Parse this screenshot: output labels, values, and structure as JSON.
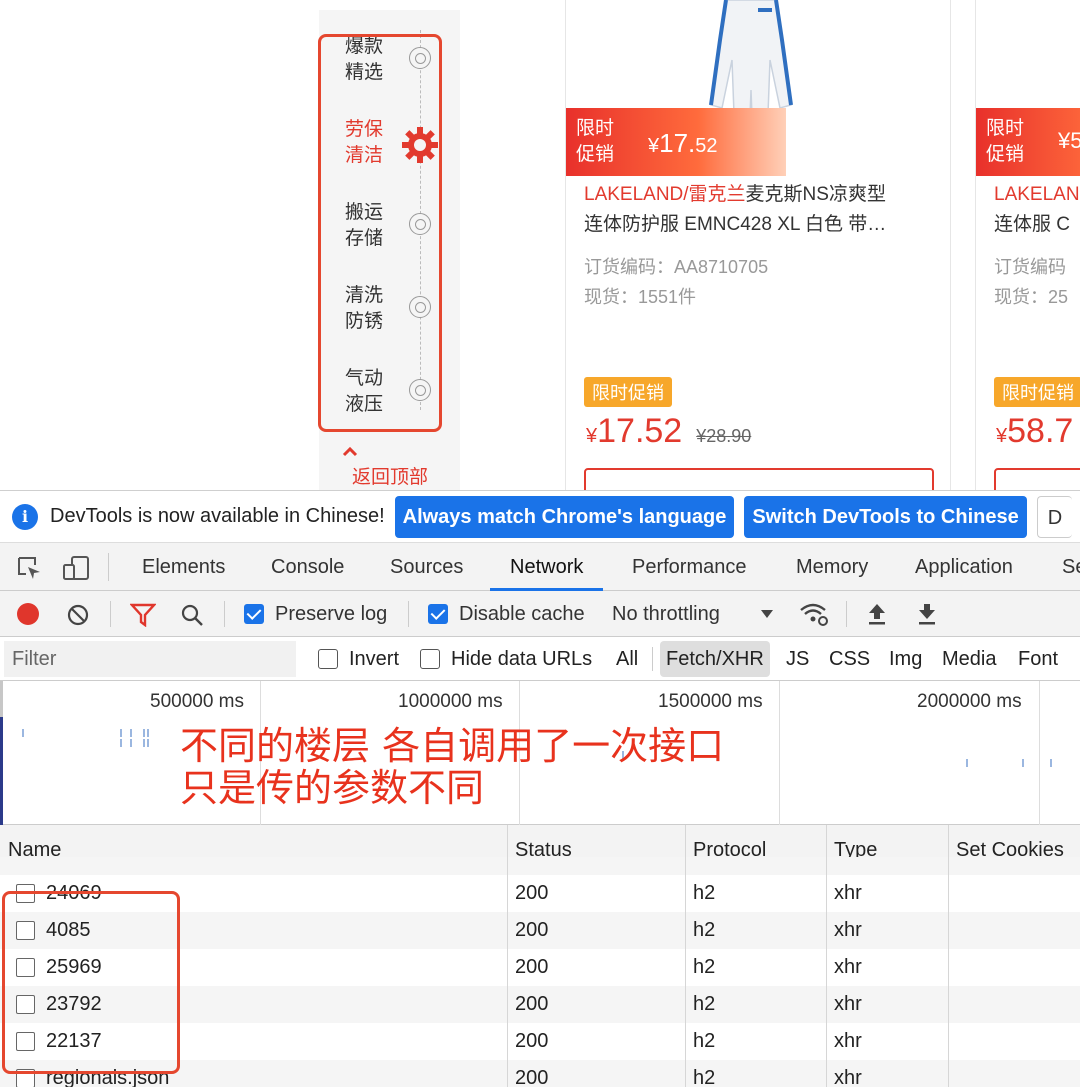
{
  "floor_nav": {
    "items": [
      {
        "label_line1": "爆款",
        "label_line2": "精选",
        "active": false
      },
      {
        "label_line1": "劳保",
        "label_line2": "清洁",
        "active": true
      },
      {
        "label_line1": "搬运",
        "label_line2": "存储",
        "active": false
      },
      {
        "label_line1": "清洗",
        "label_line2": "防锈",
        "active": false
      },
      {
        "label_line1": "气动",
        "label_line2": "液压",
        "active": false
      }
    ],
    "back_to_top": "返回顶部"
  },
  "products": [
    {
      "promo_tag_line1": "限时",
      "promo_tag_line2": "促销",
      "promo_currency": "¥",
      "promo_price_int": "17.",
      "promo_price_dec": "52",
      "brand": "LAKELAND/雷克兰",
      "title_rest": "麦克斯NS凉爽型",
      "title_line2": "连体防护服 EMNC428 XL 白色 带…",
      "order_code": "订货编码：AA8710705",
      "stock": "现货：1551件",
      "badge": "限时促销",
      "currency": "¥",
      "price": "17.52",
      "orig_price": "¥28.90"
    },
    {
      "promo_tag_line1": "限时",
      "promo_tag_line2": "促销",
      "promo_currency": "¥5",
      "brand": "LAKELAN",
      "title_line2": "连体服 C",
      "order_code": "订货编码",
      "stock": "现货：25",
      "badge": "限时促销",
      "currency": "¥",
      "price": "58.7"
    }
  ],
  "devtools": {
    "infobar": {
      "icon": "info-icon",
      "text": "DevTools is now available in Chinese!",
      "btn_match": "Always match Chrome's language",
      "btn_switch": "Switch DevTools to Chinese",
      "btn_dont": "D"
    },
    "tabs": [
      "Elements",
      "Console",
      "Sources",
      "Network",
      "Performance",
      "Memory",
      "Application",
      "Se"
    ],
    "active_tab": "Network",
    "toolbar": {
      "preserve_log": "Preserve log",
      "preserve_log_checked": true,
      "disable_cache": "Disable cache",
      "disable_cache_checked": true,
      "throttling": "No throttling"
    },
    "filter": {
      "placeholder": "Filter",
      "invert": "Invert",
      "hide_data_urls": "Hide data URLs",
      "types": [
        "All",
        "Fetch/XHR",
        "JS",
        "CSS",
        "Img",
        "Media",
        "Font"
      ],
      "active_type": "Fetch/XHR"
    },
    "timeline": {
      "ticks": [
        "500000 ms",
        "1000000 ms",
        "1500000 ms",
        "2000000 ms"
      ]
    },
    "annotation": {
      "line1": "不同的楼层 各自调用了一次接口",
      "line2": "只是传的参数不同"
    },
    "table": {
      "headers": [
        "Name",
        "Status",
        "Protocol",
        "Type",
        "Set Cookies"
      ],
      "rows": [
        {
          "name": "24069",
          "status": "200",
          "protocol": "h2",
          "type": "xhr"
        },
        {
          "name": "4085",
          "status": "200",
          "protocol": "h2",
          "type": "xhr"
        },
        {
          "name": "25969",
          "status": "200",
          "protocol": "h2",
          "type": "xhr"
        },
        {
          "name": "23792",
          "status": "200",
          "protocol": "h2",
          "type": "xhr"
        },
        {
          "name": "22137",
          "status": "200",
          "protocol": "h2",
          "type": "xhr"
        },
        {
          "name": "regionals.json",
          "status": "200",
          "protocol": "h2",
          "type": "xhr"
        }
      ]
    }
  },
  "colors": {
    "accent_red": "#e23a2e",
    "annotation_red": "#e8321d",
    "devtools_blue": "#1a73e8",
    "promo_orange": "#f7a72a"
  }
}
